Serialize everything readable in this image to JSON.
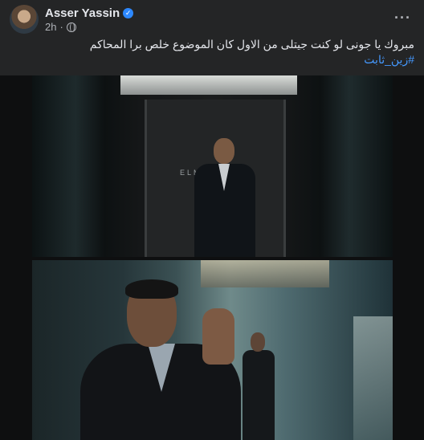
{
  "post": {
    "author": "Asser Yassin",
    "time": "2h",
    "text": "مبروك يا جونى  لو كنت جيتلى من الاول كان الموضوع خلص برا المحاكم",
    "hashtag": "#زين_ثابت"
  },
  "icons": {
    "verified": "verified-badge-icon",
    "audience": "globe-icon",
    "more": "more-options-icon"
  },
  "media": {
    "photo1": {
      "sign_text": "ELME      AN",
      "description": "man in suit standing in elevator"
    },
    "photo2": {
      "description": "man in suit waving hand in office corridor"
    }
  },
  "colors": {
    "background": "#242526",
    "text": "#e4e6eb",
    "secondary_text": "#b0b3b8",
    "hashtag": "#4599ff",
    "verified": "#2d88ff"
  }
}
